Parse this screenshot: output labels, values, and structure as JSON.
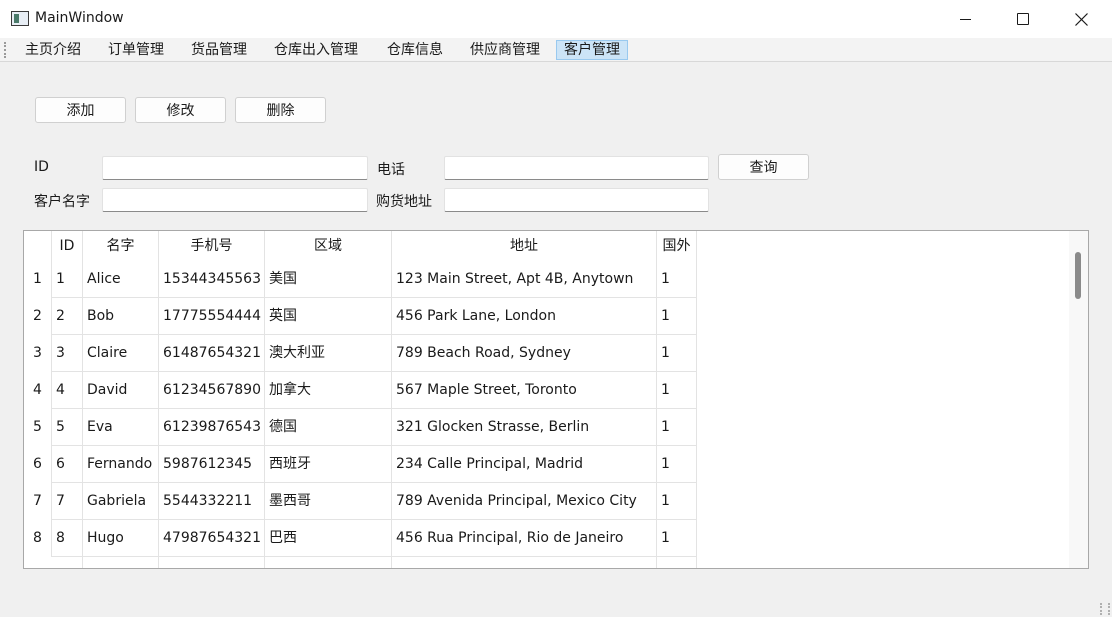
{
  "window": {
    "title": "MainWindow"
  },
  "menu": {
    "items": [
      "主页介绍",
      "订单管理",
      "货品管理",
      "仓库出入管理",
      "仓库信息",
      "供应商管理",
      "客户管理"
    ],
    "active_index": 6
  },
  "toolbar": {
    "add_label": "添加",
    "edit_label": "修改",
    "delete_label": "删除"
  },
  "search": {
    "id_label": "ID",
    "id_value": "",
    "phone_label": "电话",
    "phone_value": "",
    "query_label": "查询",
    "name_label": "客户名字",
    "name_value": "",
    "address_label": "购货地址",
    "address_value": ""
  },
  "table": {
    "columns": [
      "ID",
      "名字",
      "手机号",
      "区域",
      "地址",
      "国外"
    ],
    "rows": [
      {
        "num": "1",
        "cells": [
          "1",
          "Alice",
          "15344345563",
          "美国",
          "123 Main Street, Apt 4B, Anytown",
          "1"
        ]
      },
      {
        "num": "2",
        "cells": [
          "2",
          "Bob",
          "17775554444",
          "英国",
          "456 Park Lane, London",
          "1"
        ]
      },
      {
        "num": "3",
        "cells": [
          "3",
          "Claire",
          "61487654321",
          "澳大利亚",
          "789 Beach Road, Sydney",
          "1"
        ]
      },
      {
        "num": "4",
        "cells": [
          "4",
          "David",
          "61234567890",
          "加拿大",
          "567 Maple Street, Toronto",
          "1"
        ]
      },
      {
        "num": "5",
        "cells": [
          "5",
          "Eva",
          "61239876543",
          "德国",
          "321 Glocken Strasse, Berlin",
          "1"
        ]
      },
      {
        "num": "6",
        "cells": [
          "6",
          "Fernando",
          "5987612345",
          "西班牙",
          "234 Calle Principal, Madrid",
          "1"
        ]
      },
      {
        "num": "7",
        "cells": [
          "7",
          "Gabriela",
          "5544332211",
          "墨西哥",
          "789 Avenida Principal, Mexico City",
          "1"
        ]
      },
      {
        "num": "8",
        "cells": [
          "8",
          "Hugo",
          "47987654321",
          "巴西",
          "456 Rua Principal, Rio de Janeiro",
          "1"
        ]
      }
    ]
  },
  "icons": {
    "app": "window-app-icon",
    "minimize": "minimize-icon",
    "maximize": "maximize-icon",
    "close": "close-icon"
  }
}
